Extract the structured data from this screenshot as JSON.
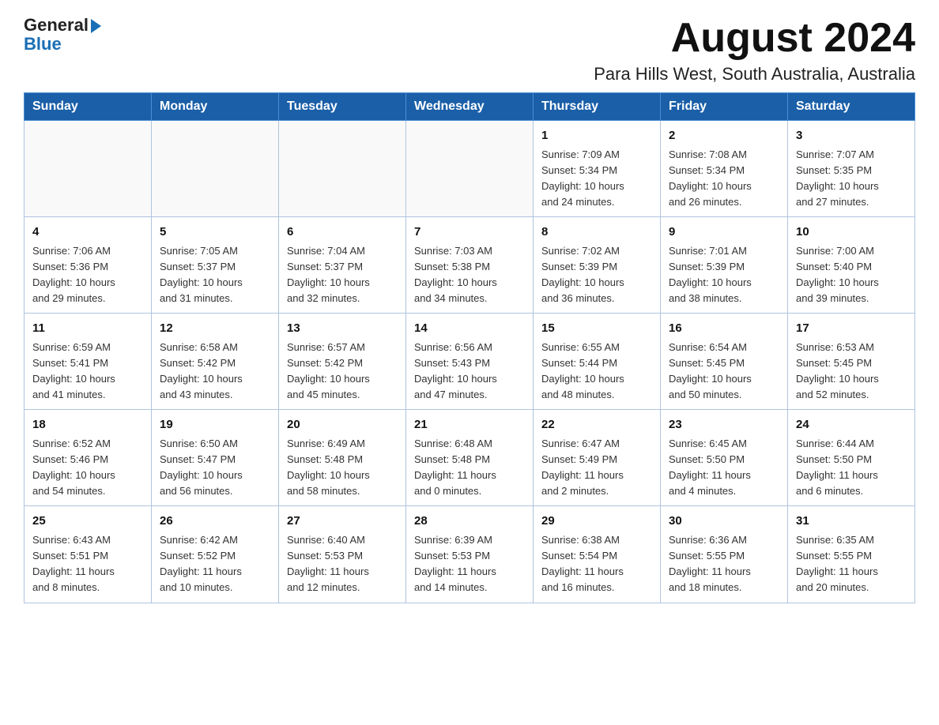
{
  "header": {
    "logo_text1": "General",
    "logo_text2": "Blue",
    "month_year": "August 2024",
    "location": "Para Hills West, South Australia, Australia"
  },
  "weekdays": [
    "Sunday",
    "Monday",
    "Tuesday",
    "Wednesday",
    "Thursday",
    "Friday",
    "Saturday"
  ],
  "weeks": [
    [
      {
        "day": "",
        "info": ""
      },
      {
        "day": "",
        "info": ""
      },
      {
        "day": "",
        "info": ""
      },
      {
        "day": "",
        "info": ""
      },
      {
        "day": "1",
        "info": "Sunrise: 7:09 AM\nSunset: 5:34 PM\nDaylight: 10 hours\nand 24 minutes."
      },
      {
        "day": "2",
        "info": "Sunrise: 7:08 AM\nSunset: 5:34 PM\nDaylight: 10 hours\nand 26 minutes."
      },
      {
        "day": "3",
        "info": "Sunrise: 7:07 AM\nSunset: 5:35 PM\nDaylight: 10 hours\nand 27 minutes."
      }
    ],
    [
      {
        "day": "4",
        "info": "Sunrise: 7:06 AM\nSunset: 5:36 PM\nDaylight: 10 hours\nand 29 minutes."
      },
      {
        "day": "5",
        "info": "Sunrise: 7:05 AM\nSunset: 5:37 PM\nDaylight: 10 hours\nand 31 minutes."
      },
      {
        "day": "6",
        "info": "Sunrise: 7:04 AM\nSunset: 5:37 PM\nDaylight: 10 hours\nand 32 minutes."
      },
      {
        "day": "7",
        "info": "Sunrise: 7:03 AM\nSunset: 5:38 PM\nDaylight: 10 hours\nand 34 minutes."
      },
      {
        "day": "8",
        "info": "Sunrise: 7:02 AM\nSunset: 5:39 PM\nDaylight: 10 hours\nand 36 minutes."
      },
      {
        "day": "9",
        "info": "Sunrise: 7:01 AM\nSunset: 5:39 PM\nDaylight: 10 hours\nand 38 minutes."
      },
      {
        "day": "10",
        "info": "Sunrise: 7:00 AM\nSunset: 5:40 PM\nDaylight: 10 hours\nand 39 minutes."
      }
    ],
    [
      {
        "day": "11",
        "info": "Sunrise: 6:59 AM\nSunset: 5:41 PM\nDaylight: 10 hours\nand 41 minutes."
      },
      {
        "day": "12",
        "info": "Sunrise: 6:58 AM\nSunset: 5:42 PM\nDaylight: 10 hours\nand 43 minutes."
      },
      {
        "day": "13",
        "info": "Sunrise: 6:57 AM\nSunset: 5:42 PM\nDaylight: 10 hours\nand 45 minutes."
      },
      {
        "day": "14",
        "info": "Sunrise: 6:56 AM\nSunset: 5:43 PM\nDaylight: 10 hours\nand 47 minutes."
      },
      {
        "day": "15",
        "info": "Sunrise: 6:55 AM\nSunset: 5:44 PM\nDaylight: 10 hours\nand 48 minutes."
      },
      {
        "day": "16",
        "info": "Sunrise: 6:54 AM\nSunset: 5:45 PM\nDaylight: 10 hours\nand 50 minutes."
      },
      {
        "day": "17",
        "info": "Sunrise: 6:53 AM\nSunset: 5:45 PM\nDaylight: 10 hours\nand 52 minutes."
      }
    ],
    [
      {
        "day": "18",
        "info": "Sunrise: 6:52 AM\nSunset: 5:46 PM\nDaylight: 10 hours\nand 54 minutes."
      },
      {
        "day": "19",
        "info": "Sunrise: 6:50 AM\nSunset: 5:47 PM\nDaylight: 10 hours\nand 56 minutes."
      },
      {
        "day": "20",
        "info": "Sunrise: 6:49 AM\nSunset: 5:48 PM\nDaylight: 10 hours\nand 58 minutes."
      },
      {
        "day": "21",
        "info": "Sunrise: 6:48 AM\nSunset: 5:48 PM\nDaylight: 11 hours\nand 0 minutes."
      },
      {
        "day": "22",
        "info": "Sunrise: 6:47 AM\nSunset: 5:49 PM\nDaylight: 11 hours\nand 2 minutes."
      },
      {
        "day": "23",
        "info": "Sunrise: 6:45 AM\nSunset: 5:50 PM\nDaylight: 11 hours\nand 4 minutes."
      },
      {
        "day": "24",
        "info": "Sunrise: 6:44 AM\nSunset: 5:50 PM\nDaylight: 11 hours\nand 6 minutes."
      }
    ],
    [
      {
        "day": "25",
        "info": "Sunrise: 6:43 AM\nSunset: 5:51 PM\nDaylight: 11 hours\nand 8 minutes."
      },
      {
        "day": "26",
        "info": "Sunrise: 6:42 AM\nSunset: 5:52 PM\nDaylight: 11 hours\nand 10 minutes."
      },
      {
        "day": "27",
        "info": "Sunrise: 6:40 AM\nSunset: 5:53 PM\nDaylight: 11 hours\nand 12 minutes."
      },
      {
        "day": "28",
        "info": "Sunrise: 6:39 AM\nSunset: 5:53 PM\nDaylight: 11 hours\nand 14 minutes."
      },
      {
        "day": "29",
        "info": "Sunrise: 6:38 AM\nSunset: 5:54 PM\nDaylight: 11 hours\nand 16 minutes."
      },
      {
        "day": "30",
        "info": "Sunrise: 6:36 AM\nSunset: 5:55 PM\nDaylight: 11 hours\nand 18 minutes."
      },
      {
        "day": "31",
        "info": "Sunrise: 6:35 AM\nSunset: 5:55 PM\nDaylight: 11 hours\nand 20 minutes."
      }
    ]
  ]
}
